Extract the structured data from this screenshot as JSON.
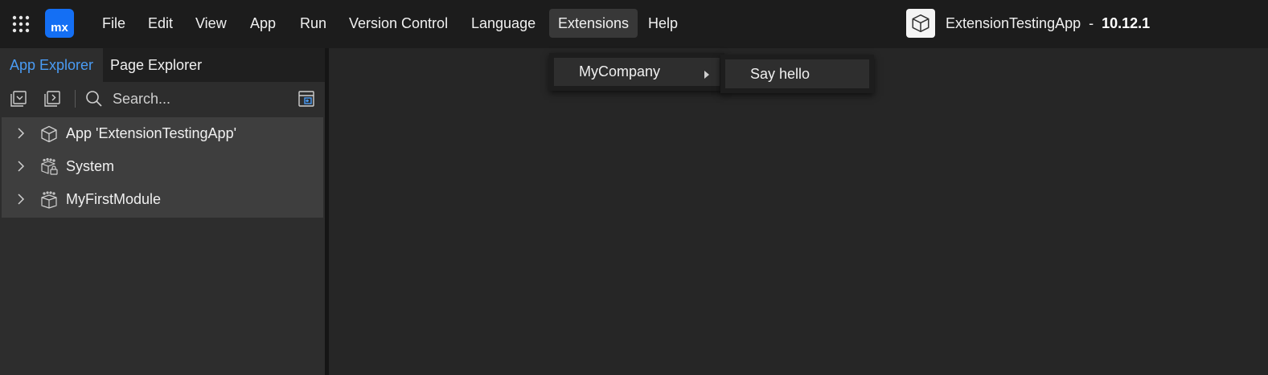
{
  "topbar": {
    "logo_text": "mx",
    "menu": [
      "File",
      "Edit",
      "View",
      "App",
      "Run",
      "Version Control",
      "Language",
      "Extensions",
      "Help"
    ],
    "active_menu": "Extensions",
    "app_name": "ExtensionTestingApp",
    "separator": "-",
    "version": "10.12.1"
  },
  "left_panel": {
    "tabs": [
      "App Explorer",
      "Page Explorer"
    ],
    "active_tab": "App Explorer",
    "search": {
      "placeholder": "Search...",
      "value": ""
    },
    "tree": [
      {
        "label": "App 'ExtensionTestingApp'",
        "icon": "cube-icon"
      },
      {
        "label": "System",
        "icon": "system-module-icon"
      },
      {
        "label": "MyFirstModule",
        "icon": "module-icon"
      }
    ]
  },
  "extensions_menu": {
    "items": [
      {
        "label": "MyCompany",
        "has_submenu": true
      }
    ],
    "submenu": [
      {
        "label": "Say hello"
      }
    ]
  },
  "colors": {
    "accent": "#4a9cf5",
    "logo_blue": "#146ff4",
    "topbar_bg": "#1c1c1c",
    "panel_bg": "#2d2d2d",
    "tree_bg": "#3e3e3e",
    "editor_bg": "#262626",
    "menu_bg": "#1d1d1d"
  }
}
